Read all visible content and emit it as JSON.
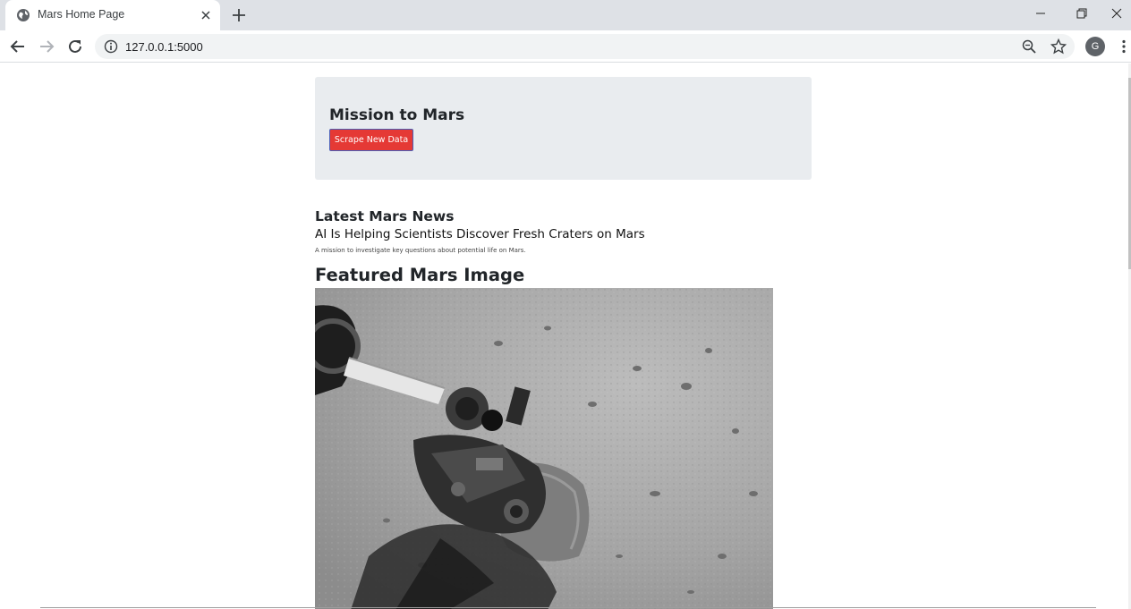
{
  "browser": {
    "tab_title": "Mars Home Page",
    "url": "127.0.0.1:5000",
    "profile_initial": "G",
    "icons": {
      "favicon": "globe-icon",
      "close": "close-icon",
      "new_tab": "plus-icon",
      "back": "arrow-left-icon",
      "forward": "arrow-right-icon",
      "reload": "reload-icon",
      "info": "info-icon",
      "zoom": "zoom-icon",
      "bookmark": "star-icon",
      "menu": "kebab-menu-icon"
    }
  },
  "page": {
    "jumbotron": {
      "title": "Mission to Mars",
      "button_label": "Scrape New Data",
      "button_color": "#e53935"
    },
    "news": {
      "heading": "Latest Mars News",
      "title": "AI Is Helping Scientists Discover Fresh Craters on Mars",
      "paragraph": "A mission to investigate key questions about potential life on Mars."
    },
    "featured_image": {
      "heading": "Featured Mars Image"
    }
  }
}
